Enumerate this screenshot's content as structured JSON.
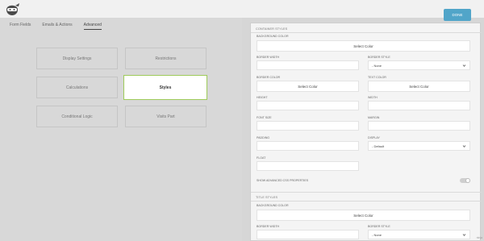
{
  "header": {
    "done_label": "DONE",
    "accent": "#51a5c9"
  },
  "tabs": [
    {
      "label": "Form Fields"
    },
    {
      "label": "Emails & Actions"
    },
    {
      "label": "Advanced"
    }
  ],
  "tiles": [
    {
      "label": "Display Settings"
    },
    {
      "label": "Restrictions"
    },
    {
      "label": "Calculations"
    },
    {
      "label": "Styles"
    },
    {
      "label": "Conditional Logic"
    },
    {
      "label": "Visits Part"
    }
  ],
  "container_styles": {
    "title": "CONTAINER STYLES",
    "background_color_label": "BACKGROUND COLOR",
    "background_color_button": "Select Color",
    "border_width_label": "BORDER WIDTH",
    "border_style_label": "BORDER STYLE",
    "border_style_value": "- None",
    "border_color_label": "BORDER COLOR",
    "border_color_button": "Select Color",
    "text_color_label": "TEXT COLOR",
    "text_color_button": "Select Color",
    "height_label": "HEIGHT",
    "width_label": "WIDTH",
    "font_size_label": "FONT SIZE",
    "margin_label": "MARGIN",
    "padding_label": "PADDING",
    "display_label": "DISPLAY",
    "display_value": "- Default",
    "float_label": "FLOAT",
    "advanced_css_label": "SHOW ADVANCED CSS PROPERTIES"
  },
  "title_styles": {
    "title": "TITLE STYLES",
    "background_color_label": "BACKGROUND COLOR",
    "background_color_button": "Select Color",
    "border_width_label": "BORDER WIDTH",
    "border_style_label": "BORDER STYLE",
    "border_style_value": "- None"
  },
  "corner_text": "ninja"
}
